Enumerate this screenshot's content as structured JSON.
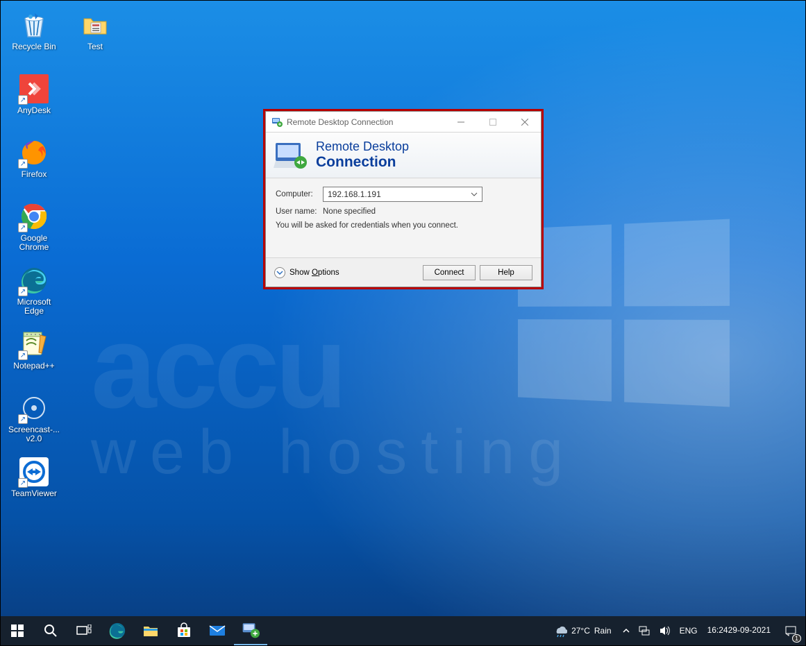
{
  "desktop_icons": {
    "recycle_bin": "Recycle Bin",
    "test": "Test",
    "anydesk": "AnyDesk",
    "firefox": "Firefox",
    "chrome": "Google Chrome",
    "edge": "Microsoft Edge",
    "notepadpp": "Notepad++",
    "screencast": "Screencast-... v2.0",
    "teamviewer": "TeamViewer"
  },
  "watermark": {
    "line1": "accu",
    "line2": "web hosting"
  },
  "rdp": {
    "title": "Remote Desktop Connection",
    "banner1": "Remote Desktop",
    "banner2": "Connection",
    "labels": {
      "computer": "Computer:",
      "username": "User name:"
    },
    "computer_value": "192.168.1.191",
    "username_value": "None specified",
    "hint": "You will be asked for credentials when you connect.",
    "show_options_prefix": "Show ",
    "show_options_underlined": "O",
    "show_options_suffix": "ptions",
    "connect": "Connect",
    "help": "Help"
  },
  "taskbar": {
    "weather_temp": "27°C",
    "weather_label": "Rain",
    "lang": "ENG",
    "time": "16:24",
    "date": "29-09-2021",
    "notif_count": "1"
  }
}
